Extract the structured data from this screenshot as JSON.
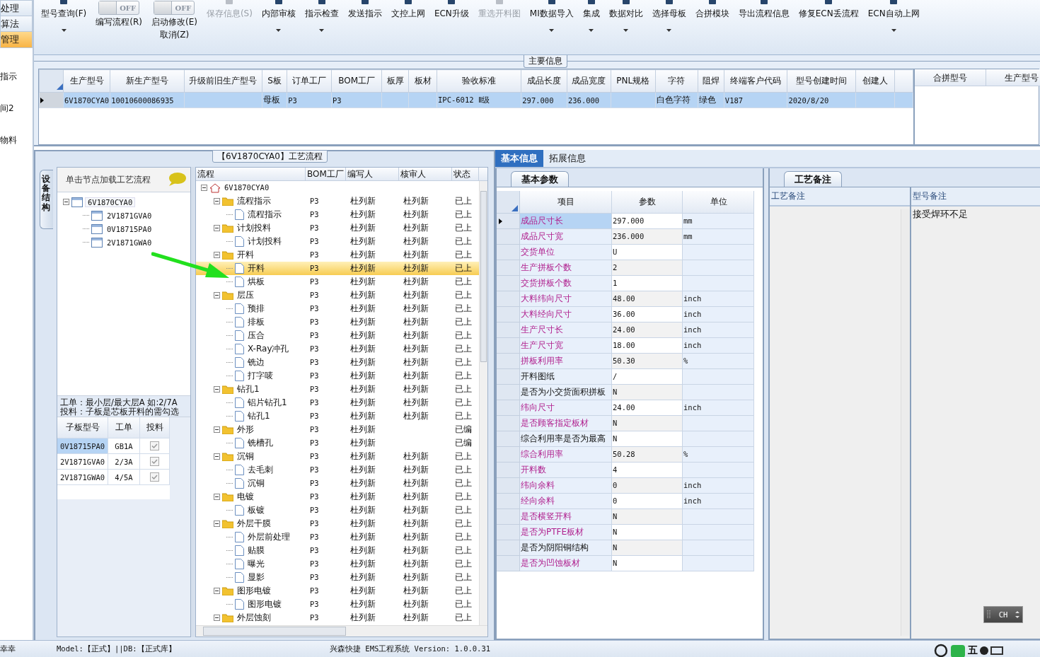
{
  "sidebar": {
    "items": [
      {
        "label": "处理",
        "kind": "button",
        "selected": false
      },
      {
        "label": "算法",
        "kind": "button",
        "selected": false
      },
      {
        "label": "管理",
        "kind": "button",
        "selected": true
      },
      {
        "label": "指示",
        "kind": "item",
        "selected": false
      },
      {
        "label": "间2",
        "kind": "item",
        "selected": false
      },
      {
        "label": "物料",
        "kind": "item",
        "selected": false
      }
    ]
  },
  "toolbar": {
    "items": [
      {
        "kind": "button",
        "label": "型号查询(F)",
        "dropdown": true,
        "disabled": false
      },
      {
        "kind": "toggle",
        "label": "编写流程(R)",
        "state_text": "OFF",
        "on": false
      },
      {
        "kind": "toggle",
        "label": "启动修改(E)",
        "label2": "取消(Z)",
        "state_text": "OFF",
        "on": false
      },
      {
        "kind": "button",
        "label": "保存信息(S)",
        "dropdown": false,
        "disabled": true
      },
      {
        "kind": "button",
        "label": "内部审核",
        "dropdown": true,
        "disabled": false
      },
      {
        "kind": "button",
        "label": "指示检查",
        "dropdown": true,
        "disabled": false
      },
      {
        "kind": "button",
        "label": "发送指示",
        "dropdown": false,
        "disabled": false
      },
      {
        "kind": "button",
        "label": "文控上网",
        "dropdown": false,
        "disabled": false
      },
      {
        "kind": "button",
        "label": "ECN升级",
        "dropdown": false,
        "disabled": false
      },
      {
        "kind": "button",
        "label": "重选开料图",
        "dropdown": false,
        "disabled": true
      },
      {
        "kind": "button",
        "label": "MI数据导入",
        "dropdown": true,
        "disabled": false
      },
      {
        "kind": "button",
        "label": "集成",
        "dropdown": true,
        "disabled": false
      },
      {
        "kind": "button",
        "label": "数据对比",
        "dropdown": true,
        "disabled": false
      },
      {
        "kind": "button",
        "label": "选择母板",
        "dropdown": true,
        "disabled": false
      },
      {
        "kind": "button",
        "label": "合拼模块",
        "dropdown": false,
        "disabled": false
      },
      {
        "kind": "button",
        "label": "导出流程信息",
        "dropdown": false,
        "disabled": false
      },
      {
        "kind": "button",
        "label": "修复ECN丢流程",
        "dropdown": false,
        "disabled": false
      },
      {
        "kind": "button",
        "label": "ECN自动上网",
        "dropdown": true,
        "disabled": false
      }
    ]
  },
  "main_info": {
    "title": "主要信息",
    "table": {
      "columns": [
        "生产型号",
        "新生产型号",
        "升级前旧生产型号",
        "S板",
        "订单工厂",
        "BOM工厂",
        "板厚",
        "板材",
        "验收标准",
        "成品长度",
        "成品宽度",
        "PNL规格",
        "字符",
        "阻焊",
        "终端客户代码",
        "型号创建时间",
        "创建人"
      ],
      "rows": [
        {
          "selected": true,
          "cells": [
            "6V1870CYA0",
            "10010600086935",
            "",
            "母板",
            "P3",
            "P3",
            "",
            "",
            "IPC-6012 Ⅱ级",
            "297.000",
            "236.000",
            "",
            "白色字符",
            "绿色",
            "V187",
            "2020/8/20",
            ""
          ]
        }
      ]
    },
    "merge_table": {
      "columns": [
        "合拼型号",
        "生产型号"
      ]
    }
  },
  "process_panel": {
    "title": "【6V1870CYA0】工艺流程",
    "side_tab": "设备结构",
    "structure": {
      "hint": "单击节点加载工艺流程",
      "tree": [
        {
          "label": "6V1870CYA0",
          "expanded": true,
          "selected": true,
          "children": [
            {
              "label": "2V1871GVA0",
              "selected": false
            },
            {
              "label": "0V18715PA0",
              "selected": false
            },
            {
              "label": "2V1871GWA0",
              "selected": false
            }
          ]
        }
      ],
      "note_lines": [
        "工单：最小层/最大层A 如:2/7A",
        "投料：子板是芯板开料的需勾选"
      ],
      "sub_table": {
        "columns": [
          "子板型号",
          "工单",
          "投料"
        ],
        "rows": [
          {
            "board": "0V18715PA0",
            "order": "GB1A",
            "feed": true,
            "selected": true
          },
          {
            "board": "2V1871GVA0",
            "order": "2/3A",
            "feed": true,
            "selected": false
          },
          {
            "board": "2V1871GWA0",
            "order": "4/5A",
            "feed": true,
            "selected": false
          }
        ]
      }
    },
    "flow": {
      "columns": [
        "流程",
        "BOM工厂",
        "编写人",
        "核审人",
        "状态"
      ],
      "tree": [
        {
          "kind": "root",
          "name": "6V1870CYA0",
          "expanded": true,
          "selected": false,
          "children": [
            {
              "kind": "folder",
              "name": "流程指示",
              "bom": "P3",
              "writer": "杜列新",
              "reviewer": "杜列新",
              "status": "已上",
              "expanded": true,
              "selected": false,
              "children": [
                {
                  "kind": "file",
                  "name": "流程指示",
                  "bom": "P3",
                  "writer": "杜列新",
                  "reviewer": "杜列新",
                  "status": "已上",
                  "selected": false
                }
              ]
            },
            {
              "kind": "folder",
              "name": "计划投料",
              "bom": "P3",
              "writer": "杜列新",
              "reviewer": "杜列新",
              "status": "已上",
              "expanded": true,
              "selected": false,
              "children": [
                {
                  "kind": "file",
                  "name": "计划投料",
                  "bom": "P3",
                  "writer": "杜列新",
                  "reviewer": "杜列新",
                  "status": "已上",
                  "selected": false
                }
              ]
            },
            {
              "kind": "folder",
              "name": "开料",
              "bom": "P3",
              "writer": "杜列新",
              "reviewer": "杜列新",
              "status": "已上",
              "expanded": true,
              "selected": false,
              "children": [
                {
                  "kind": "file",
                  "name": "开料",
                  "bom": "P3",
                  "writer": "杜列新",
                  "reviewer": "杜列新",
                  "status": "已上",
                  "selected": true
                },
                {
                  "kind": "file",
                  "name": "烘板",
                  "bom": "P3",
                  "writer": "杜列新",
                  "reviewer": "杜列新",
                  "status": "已上",
                  "selected": false
                }
              ]
            },
            {
              "kind": "folder",
              "name": "层压",
              "bom": "P3",
              "writer": "杜列新",
              "reviewer": "杜列新",
              "status": "已上",
              "expanded": true,
              "selected": false,
              "children": [
                {
                  "kind": "file",
                  "name": "预排",
                  "bom": "P3",
                  "writer": "杜列新",
                  "reviewer": "杜列新",
                  "status": "已上",
                  "selected": false
                },
                {
                  "kind": "file",
                  "name": "排板",
                  "bom": "P3",
                  "writer": "杜列新",
                  "reviewer": "杜列新",
                  "status": "已上",
                  "selected": false
                },
                {
                  "kind": "file",
                  "name": "压合",
                  "bom": "P3",
                  "writer": "杜列新",
                  "reviewer": "杜列新",
                  "status": "已上",
                  "selected": false
                },
                {
                  "kind": "file",
                  "name": "X-Ray冲孔",
                  "bom": "P3",
                  "writer": "杜列新",
                  "reviewer": "杜列新",
                  "status": "已上",
                  "selected": false
                },
                {
                  "kind": "file",
                  "name": "铣边",
                  "bom": "P3",
                  "writer": "杜列新",
                  "reviewer": "杜列新",
                  "status": "已上",
                  "selected": false
                },
                {
                  "kind": "file",
                  "name": "打字唛",
                  "bom": "P3",
                  "writer": "杜列新",
                  "reviewer": "杜列新",
                  "status": "已上",
                  "selected": false
                }
              ]
            },
            {
              "kind": "folder",
              "name": "钻孔1",
              "bom": "P3",
              "writer": "杜列新",
              "reviewer": "杜列新",
              "status": "已上",
              "expanded": true,
              "selected": false,
              "children": [
                {
                  "kind": "file",
                  "name": "铝片钻孔1",
                  "bom": "P3",
                  "writer": "杜列新",
                  "reviewer": "杜列新",
                  "status": "已上",
                  "selected": false
                },
                {
                  "kind": "file",
                  "name": "钻孔1",
                  "bom": "P3",
                  "writer": "杜列新",
                  "reviewer": "杜列新",
                  "status": "已上",
                  "selected": false
                }
              ]
            },
            {
              "kind": "folder",
              "name": "外形",
              "bom": "P3",
              "writer": "杜列新",
              "status": "已编",
              "expanded": true,
              "selected": false,
              "children": [
                {
                  "kind": "file",
                  "name": "铣槽孔",
                  "bom": "P3",
                  "writer": "杜列新",
                  "status": "已编",
                  "selected": false
                }
              ]
            },
            {
              "kind": "folder",
              "name": "沉铜",
              "bom": "P3",
              "writer": "杜列新",
              "reviewer": "杜列新",
              "status": "已上",
              "expanded": true,
              "selected": false,
              "children": [
                {
                  "kind": "file",
                  "name": "去毛刺",
                  "bom": "P3",
                  "writer": "杜列新",
                  "reviewer": "杜列新",
                  "status": "已上",
                  "selected": false
                },
                {
                  "kind": "file",
                  "name": "沉铜",
                  "bom": "P3",
                  "writer": "杜列新",
                  "reviewer": "杜列新",
                  "status": "已上",
                  "selected": false
                }
              ]
            },
            {
              "kind": "folder",
              "name": "电镀",
              "bom": "P3",
              "writer": "杜列新",
              "reviewer": "杜列新",
              "status": "已上",
              "expanded": true,
              "selected": false,
              "children": [
                {
                  "kind": "file",
                  "name": "板镀",
                  "bom": "P3",
                  "writer": "杜列新",
                  "reviewer": "杜列新",
                  "status": "已上",
                  "selected": false
                }
              ]
            },
            {
              "kind": "folder",
              "name": "外层干膜",
              "bom": "P3",
              "writer": "杜列新",
              "reviewer": "杜列新",
              "status": "已上",
              "expanded": true,
              "selected": false,
              "children": [
                {
                  "kind": "file",
                  "name": "外层前处理",
                  "bom": "P3",
                  "writer": "杜列新",
                  "reviewer": "杜列新",
                  "status": "已上",
                  "selected": false
                },
                {
                  "kind": "file",
                  "name": "贴膜",
                  "bom": "P3",
                  "writer": "杜列新",
                  "reviewer": "杜列新",
                  "status": "已上",
                  "selected": false
                },
                {
                  "kind": "file",
                  "name": "曝光",
                  "bom": "P3",
                  "writer": "杜列新",
                  "reviewer": "杜列新",
                  "status": "已上",
                  "selected": false
                },
                {
                  "kind": "file",
                  "name": "显影",
                  "bom": "P3",
                  "writer": "杜列新",
                  "reviewer": "杜列新",
                  "status": "已上",
                  "selected": false
                }
              ]
            },
            {
              "kind": "folder",
              "name": "图形电镀",
              "bom": "P3",
              "writer": "杜列新",
              "reviewer": "杜列新",
              "status": "已上",
              "expanded": true,
              "selected": false,
              "children": [
                {
                  "kind": "file",
                  "name": "图形电镀",
                  "bom": "P3",
                  "writer": "杜列新",
                  "reviewer": "杜列新",
                  "status": "已上",
                  "selected": false
                }
              ]
            },
            {
              "kind": "folder",
              "name": "外层蚀刻",
              "bom": "P3",
              "writer": "杜列新",
              "reviewer": "杜列新",
              "status": "已上",
              "expanded": true,
              "selected": false
            }
          ]
        }
      ]
    }
  },
  "detail_panel": {
    "tabs": [
      {
        "label": "基本信息",
        "selected": true
      },
      {
        "label": "拓展信息",
        "selected": false
      }
    ],
    "params": {
      "title": "基本参数",
      "columns": [
        "项目",
        "参数",
        "单位"
      ],
      "rows": [
        {
          "item": "成品尺寸长",
          "value": "297.000",
          "unit": "mm",
          "emphasized": true,
          "selected": true
        },
        {
          "item": "成品尺寸宽",
          "value": "236.000",
          "unit": "mm",
          "emphasized": true,
          "selected": false
        },
        {
          "item": "交货单位",
          "value": "U",
          "emphasized": true,
          "selected": false
        },
        {
          "item": "生产拼板个数",
          "value": "2",
          "emphasized": true,
          "selected": false
        },
        {
          "item": "交货拼板个数",
          "value": "1",
          "emphasized": true,
          "selected": false
        },
        {
          "item": "大料纬向尺寸",
          "value": "48.00",
          "unit": "inch",
          "emphasized": true,
          "selected": false
        },
        {
          "item": "大料经向尺寸",
          "value": "36.00",
          "unit": "inch",
          "emphasized": true,
          "selected": false
        },
        {
          "item": "生产尺寸长",
          "value": "24.00",
          "unit": "inch",
          "emphasized": true,
          "selected": false
        },
        {
          "item": "生产尺寸宽",
          "value": "18.00",
          "unit": "inch",
          "emphasized": true,
          "selected": false
        },
        {
          "item": "拼板利用率",
          "value": "50.30",
          "unit": "%",
          "emphasized": true,
          "selected": false
        },
        {
          "item": "开料图纸",
          "value": "/",
          "emphasized": false,
          "selected": false
        },
        {
          "item": "是否为小交货面积拼板",
          "value": "N",
          "emphasized": false,
          "selected": false
        },
        {
          "item": "纬向尺寸",
          "value": "24.00",
          "unit": "inch",
          "emphasized": true,
          "selected": false
        },
        {
          "item": "是否顾客指定板材",
          "value": "N",
          "emphasized": true,
          "selected": false
        },
        {
          "item": "综合利用率是否为最高",
          "value": "N",
          "emphasized": false,
          "selected": false
        },
        {
          "item": "综合利用率",
          "value": "50.28",
          "unit": "%",
          "emphasized": true,
          "selected": false
        },
        {
          "item": "开料数",
          "value": "4",
          "emphasized": true,
          "selected": false
        },
        {
          "item": "纬向余料",
          "value": "0",
          "unit": "inch",
          "emphasized": true,
          "selected": false
        },
        {
          "item": "经向余料",
          "value": "0",
          "unit": "inch",
          "emphasized": true,
          "selected": false
        },
        {
          "item": "是否横竖开料",
          "value": "N",
          "emphasized": true,
          "selected": false
        },
        {
          "item": "是否为PTFE板材",
          "value": "N",
          "emphasized": true,
          "selected": false
        },
        {
          "item": "是否为阴阳铜结构",
          "value": "N",
          "emphasized": false,
          "selected": false
        },
        {
          "item": "是否为凹蚀板材",
          "value": "N",
          "emphasized": true,
          "selected": false
        }
      ]
    },
    "notes": {
      "title": "工艺备注",
      "columns": [
        "工艺备注",
        "型号备注"
      ],
      "model_note": "接受焊环不足"
    }
  },
  "ime": {
    "label": "CH"
  },
  "status_bar": {
    "user": "幸幸",
    "model": "Model:【正式】||DB:【正式库】",
    "app": "兴森快捷 EMS工程系统 Version: 1.0.0.31",
    "tray_text": "五"
  }
}
